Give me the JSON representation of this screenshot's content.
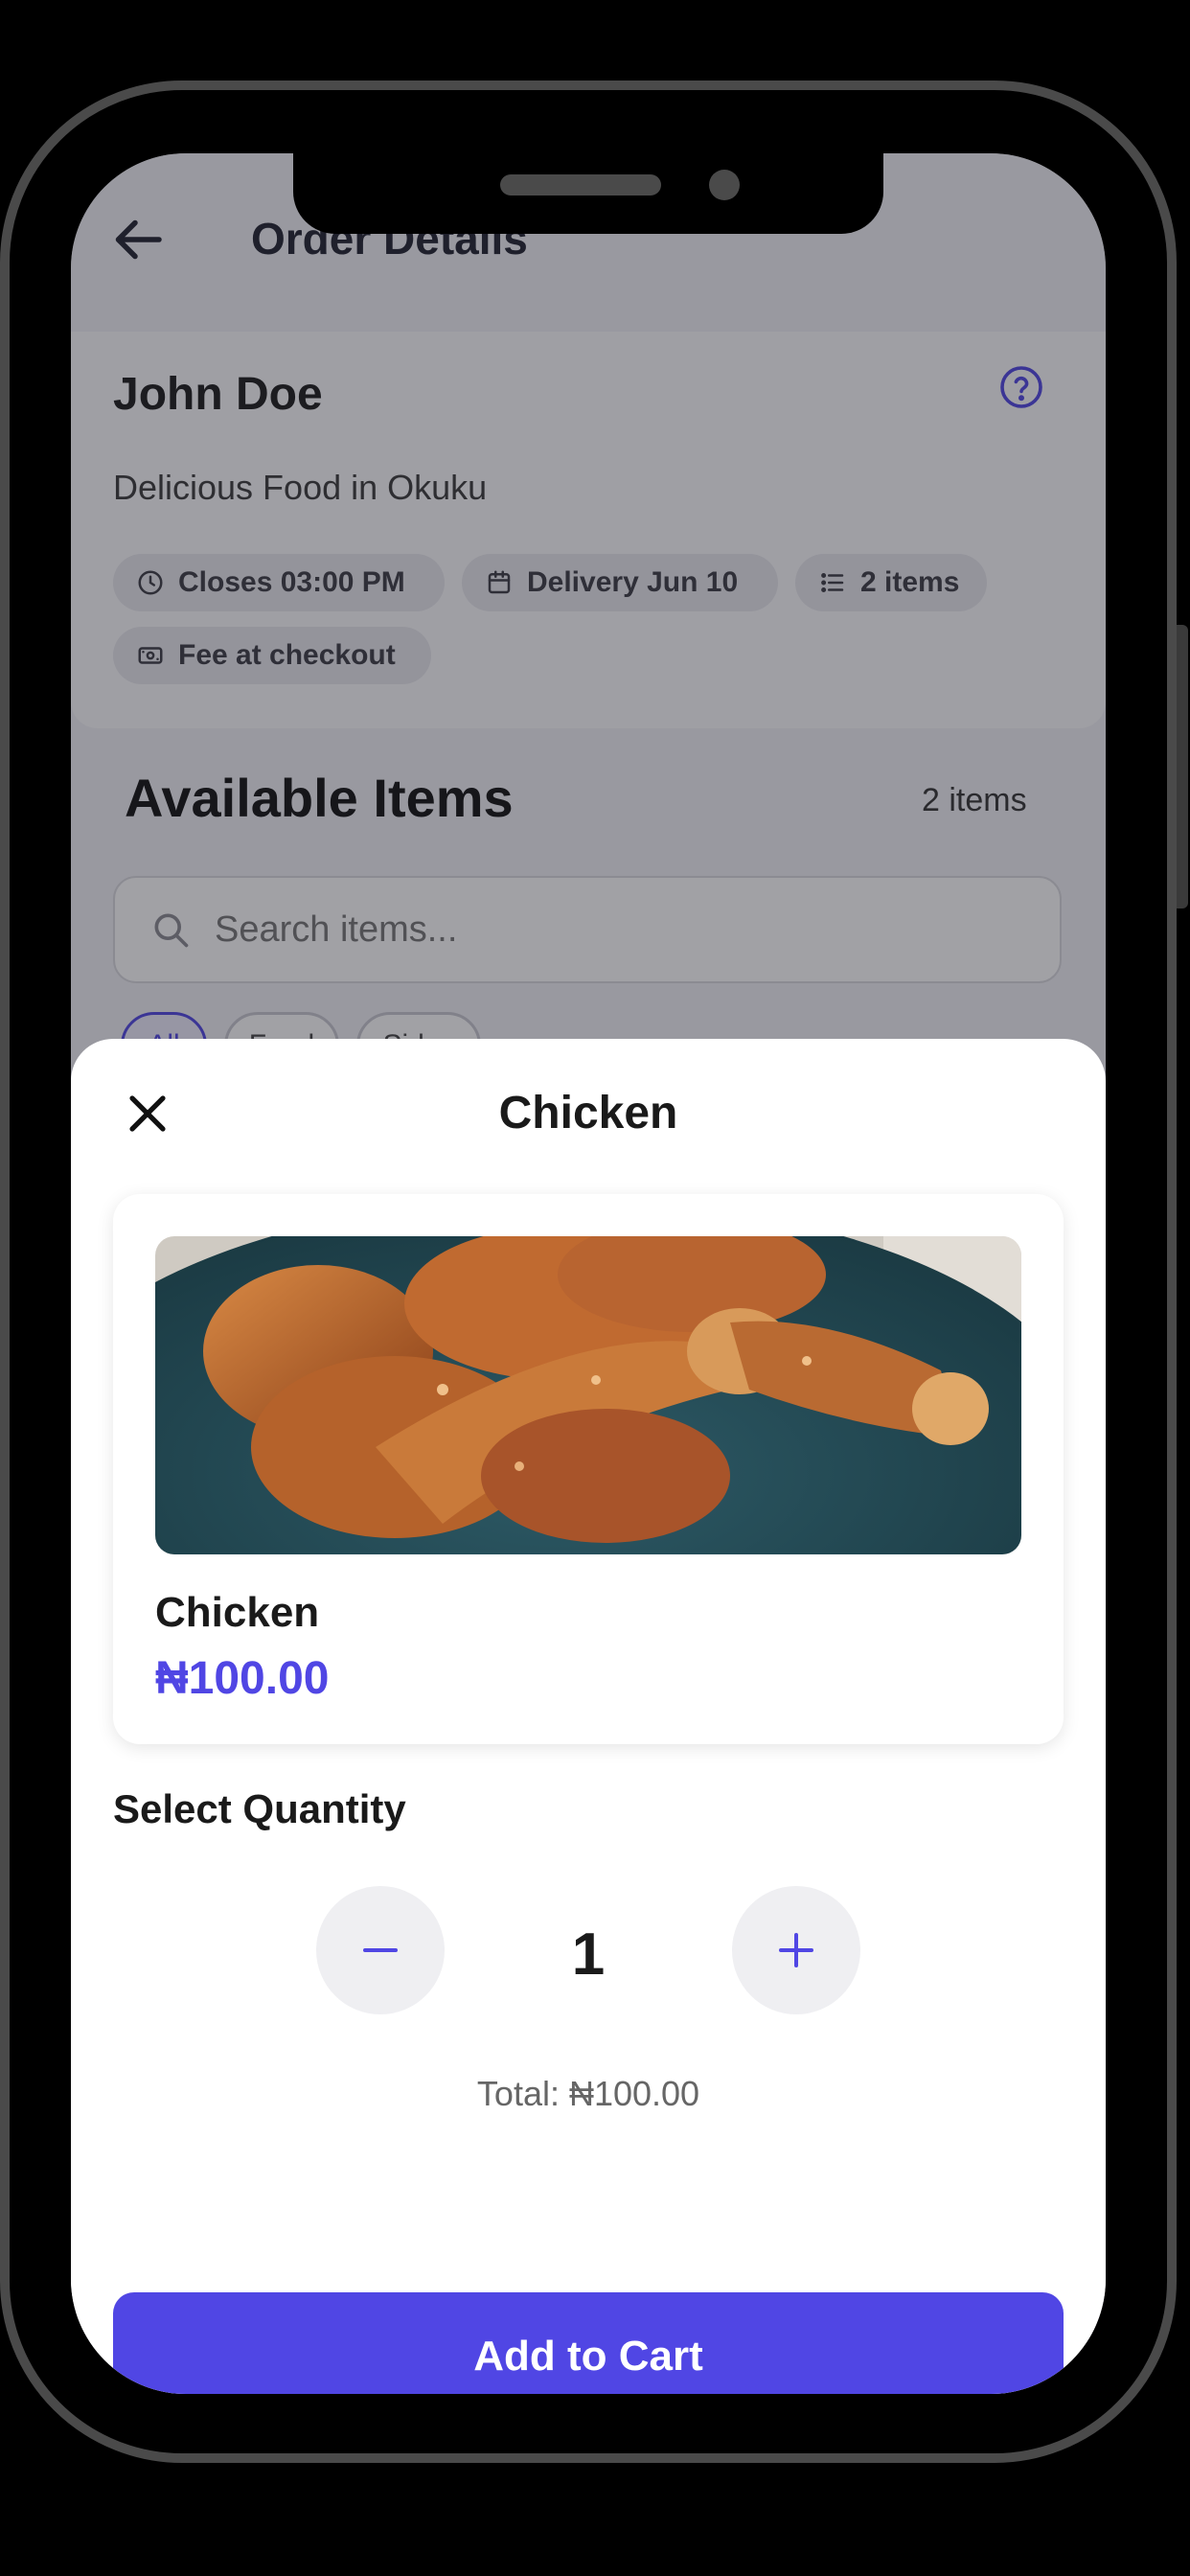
{
  "header": {
    "title": "Order Details"
  },
  "vendor": {
    "name": "John Doe",
    "description": "Delicious Food in Okuku",
    "chips": [
      {
        "icon": "clock-icon",
        "label": "Closes 03:00 PM"
      },
      {
        "icon": "calendar-icon",
        "label": "Delivery Jun 10"
      },
      {
        "icon": "list-icon",
        "label": "2 items"
      },
      {
        "icon": "money-icon",
        "label": "Fee at checkout"
      }
    ]
  },
  "items_section": {
    "title": "Available Items",
    "count": "2 items",
    "search_placeholder": "Search items...",
    "filters": [
      "All",
      "Food",
      "Sides"
    ]
  },
  "sheet": {
    "title": "Chicken",
    "product": {
      "name": "Chicken",
      "price": "₦100.00",
      "image": "fried-chicken-photo"
    },
    "quantity_label": "Select Quantity",
    "quantity": "1",
    "total": "Total: ₦100.00",
    "add_to_cart": "Add to Cart"
  },
  "colors": {
    "accent": "#5046e4",
    "overlay": "rgba(30,30,40,0.42)"
  }
}
